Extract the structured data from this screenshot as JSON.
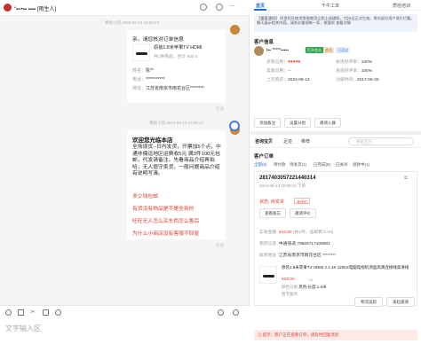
{
  "chat": {
    "contact_name": "“▪=•▪▪ ▪▪▪▪ [陌生人]",
    "timestamp_1": "青松小凯 2023-06-13 10:09:24",
    "order_card": {
      "title": "亲，请您核对订单信息",
      "product": "原装1.8米苹果TV HDMI",
      "price": "共1件商品，合计 ¥34.0",
      "name_label": "姓名：",
      "name_value": "陈**",
      "phone_label": "电话：",
      "phone_value": "***********",
      "addr_label": "地址：",
      "addr_value": "江苏省南京市雨花台区********"
    },
    "read_1": "已读",
    "timestamp_2": "青松小凯 2023-06-13 10:09:24",
    "welcome": {
      "title": "欢迎您光临本店",
      "body": "全场现货--日内发货，开票加5个点，中通非偏远地区运费收5元 满3件100元包邮，代发请备注。先看商品介绍再拍哈，无人值守卖货，一般问题商品介绍有说明写清。",
      "links": [
        "多少钱包邮",
        "有货没有物品是不是全新的",
        "旺旺无人怎么买东西怎么售后",
        "为什么小商店没有客服不回复"
      ]
    },
    "read_2": "已读",
    "input_placeholder": "文字输入区"
  },
  "right": {
    "tabs": [
      "首页",
      "千牛工单",
      "质检培训"
    ],
    "notice": "【重要通知】 阿里旺旺使用常规使用立即上线通知，7月6日正式生效。将对部分用户进行拦截。聊天展示相关内容。请务必重视每一条，按要求 查看详情",
    "customer_info_title": "客户信息",
    "customer_name": "t▪▪ *****▪▪▪▪▪",
    "customer_badges": [
      "打开会员",
      "会员",
      "已买过"
    ],
    "stats": [
      {
        "label": "买家信用：",
        "value": "♥♥♥♥♥"
      },
      {
        "label": "收货好评率：",
        "value": "100%"
      },
      {
        "label": "卖家信用：",
        "value": "--"
      },
      {
        "label": "发货好评率：",
        "value": "100%"
      },
      {
        "label": "上次购买：",
        "value": "2022-08-13"
      },
      {
        "label": "注册时间：",
        "value": "2017-06-20"
      }
    ],
    "actions": [
      "添加备注",
      "设置分组",
      "邀请入群"
    ],
    "recommend_tabs": [
      "咨询宝贝",
      "足迹",
      "推荐"
    ],
    "recommend_search": "搜索宝贝",
    "order_title": "客户订单",
    "order_tabs": [
      "全部(9)",
      "待付款",
      "待发货(1)",
      "已完成(8)",
      "已关闭",
      "退款中(1)"
    ],
    "order": {
      "id": "2817403057221440314",
      "time": "2023-06-13 10:09:15 下单",
      "status": "状态: 待发货",
      "status_tag": "未评价",
      "btn_detail": "查看备忘",
      "btn_review": "邀请评价",
      "amount_label": "实收金额",
      "amount": "¥34.00",
      "amount_note": "(共1件，含邮费:0.00)",
      "ship_label": "物流信息",
      "ship_value": "中通快递,78605717108981",
      "addr_label": "收货地址",
      "addr_value": "江苏省南京市雨花台区 ********",
      "item_title": "原装1.8米苹果TV HDMI 2.1 4K 120Hz电脑电视机顶盒高清连接线高清线",
      "item_price": "¥29.00",
      "item_qty": "×1",
      "item_sku_label": "颜色分类",
      "item_sku": "黑色;长度:1.8米",
      "refund_label": "暂无服务",
      "btn_logistics": "物流追踪",
      "btn_more": "发起邀请"
    },
    "footer_tip": "⚠ 提示：客户正在查看订单，请及时回复消息",
    "colors": {
      "accent": "#1f6fe0",
      "red": "#e23b2e",
      "green": "#2aa54d"
    }
  }
}
